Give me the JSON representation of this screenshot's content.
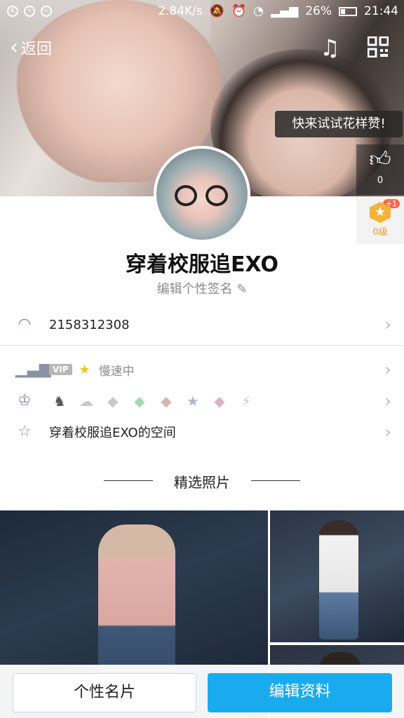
{
  "status_bar": {
    "network_speed": "2.84K/s",
    "battery": "26%",
    "time": "21:44"
  },
  "nav": {
    "back_label": "返回",
    "music_icon": "music-note-play-icon",
    "qr_icon": "qr-code-icon"
  },
  "praise": {
    "tooltip": "快来试试花样赞!",
    "count": "0"
  },
  "level": {
    "label": "0级",
    "badge": "+1"
  },
  "profile": {
    "nickname": "穿着校服追EXO",
    "signature": "编辑个性签名"
  },
  "rows": {
    "qq_number": "2158312308",
    "vip_tag": "VIP",
    "vip_status": "慢速中",
    "space_label": "穿着校服追EXO的空间"
  },
  "medals": [
    "penguin-medal-icon",
    "cloud-medal-icon",
    "diamond-medal-icon",
    "diamond-green-medal-icon",
    "diamond-pink-medal-icon",
    "star-medal-icon",
    "diamond-purple-medal-icon",
    "lightning-medal-icon"
  ],
  "section": {
    "title": "精选照片"
  },
  "bottom": {
    "card_button": "个性名片",
    "edit_button": "编辑资料"
  },
  "colors": {
    "accent": "#1aabee",
    "level_orange": "#f2b33b",
    "badge_red": "#f46a4a"
  }
}
